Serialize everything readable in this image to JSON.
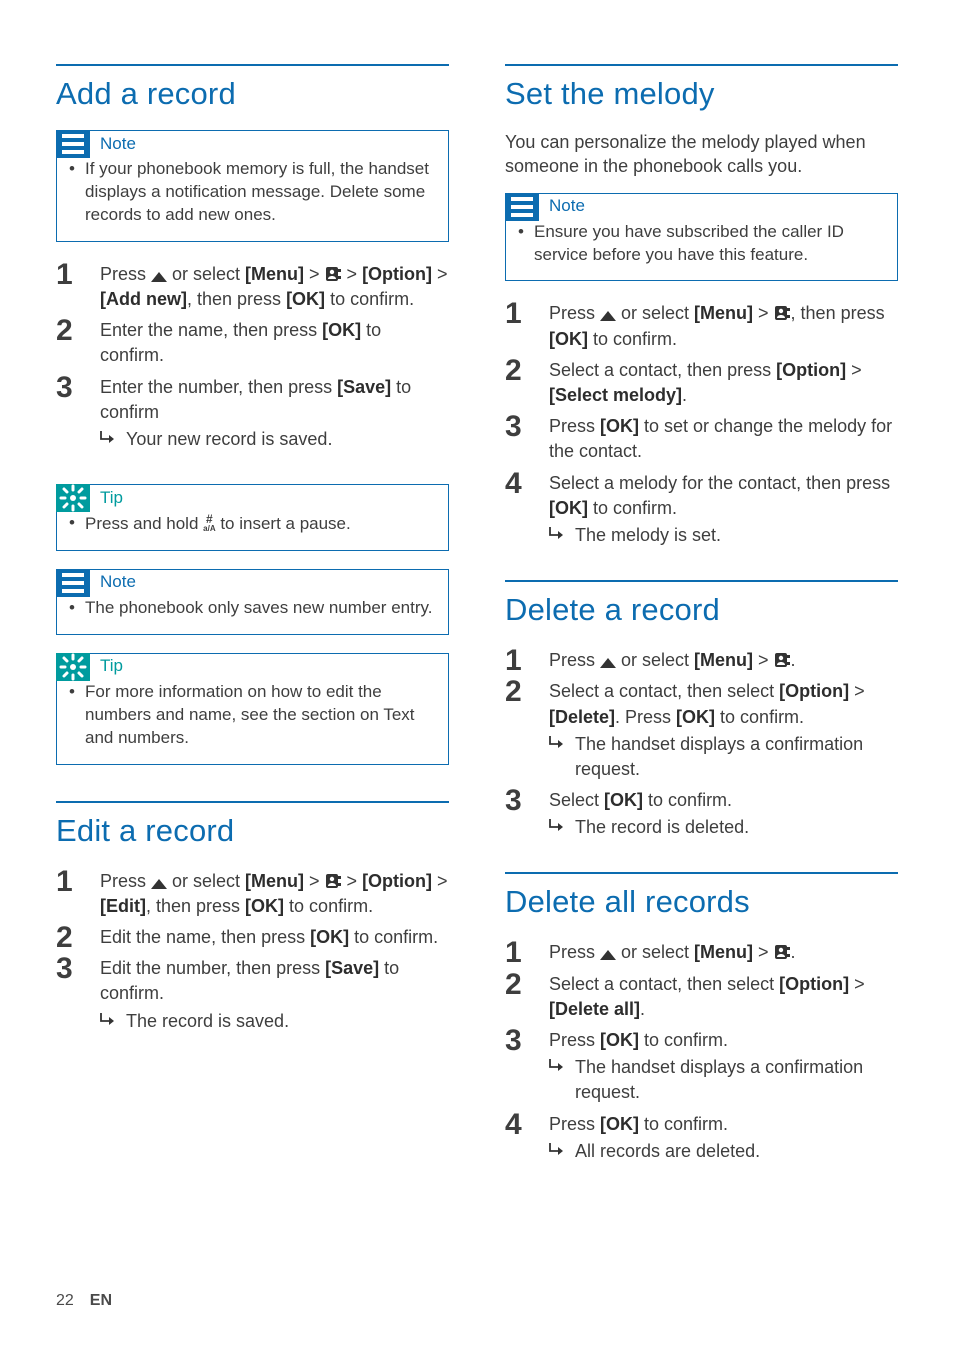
{
  "footer": {
    "page": "22",
    "lang": "EN"
  },
  "labels": {
    "note": "Note",
    "tip": "Tip"
  },
  "left": {
    "add": {
      "heading": "Add a record",
      "note1": "If your phonebook memory is full, the handset displays a notification message. Delete some records to add new ones.",
      "steps": [
        {
          "pre": "Press ",
          "seq": [
            " or select ",
            "[Menu]",
            " > ",
            "PB",
            " > ",
            "[Option]",
            " > ",
            "[Add new]",
            ", then press ",
            "[OK]",
            " to confirm."
          ]
        },
        {
          "pre": "Enter the name, then press ",
          "seq": [
            "[OK]",
            " to confirm."
          ]
        },
        {
          "pre": "Enter the number, then press ",
          "seq": [
            "[Save]",
            " to confirm"
          ],
          "result": "Your new record is saved."
        }
      ],
      "tip1_a": "Press and hold ",
      "tip1_b": " to insert a pause.",
      "note2": "The phonebook only saves new number entry.",
      "tip2": "For more information on how to edit the numbers and name, see the section on Text and numbers."
    },
    "edit": {
      "heading": "Edit a record",
      "steps": [
        {
          "pre": "Press ",
          "seq": [
            " or select ",
            "[Menu]",
            " > ",
            "PB",
            " > ",
            "[Option]",
            " > ",
            "[Edit]",
            ", then press ",
            "[OK]",
            " to confirm."
          ]
        },
        {
          "pre": "Edit the name, then press ",
          "seq": [
            "[OK]",
            " to confirm."
          ]
        },
        {
          "pre": "Edit the number, then press ",
          "seq": [
            "[Save]",
            " to confirm."
          ],
          "result": "The record is saved."
        }
      ]
    }
  },
  "right": {
    "melody": {
      "heading": "Set the melody",
      "intro": "You can personalize the melody played when someone in the phonebook calls you.",
      "note": "Ensure you have subscribed the caller ID service before you have this feature.",
      "steps": [
        {
          "pre": "Press ",
          "seq": [
            " or select ",
            "[Menu]",
            " > ",
            "PB",
            ", then press ",
            "[OK]",
            " to confirm."
          ]
        },
        {
          "pre": "Select a contact, then press ",
          "seq": [
            "[Option]",
            " > ",
            "[Select melody]",
            "."
          ]
        },
        {
          "pre": "Press ",
          "seq": [
            "[OK]",
            " to set or change the melody for the contact."
          ]
        },
        {
          "pre": "Select a melody for the contact, then press ",
          "seq": [
            "[OK]",
            " to confirm."
          ],
          "result": "The melody is set."
        }
      ]
    },
    "delete": {
      "heading": "Delete a record",
      "steps": [
        {
          "pre": "Press ",
          "seq": [
            " or select ",
            "[Menu]",
            " > ",
            "PB",
            "."
          ]
        },
        {
          "pre": "Select a contact, then select ",
          "seq": [
            "[Option]",
            " > ",
            "[Delete]",
            ". Press ",
            "[OK]",
            " to confirm."
          ],
          "result": "The handset displays a confirmation request."
        },
        {
          "pre": "Select ",
          "seq": [
            "[OK]",
            " to confirm."
          ],
          "result": "The record is deleted."
        }
      ]
    },
    "deleteAll": {
      "heading": "Delete all records",
      "steps": [
        {
          "pre": "Press ",
          "seq": [
            " or select ",
            "[Menu]",
            " > ",
            "PB",
            "."
          ]
        },
        {
          "pre": "Select a contact, then select ",
          "seq": [
            "[Option]",
            " > ",
            "[Delete all]",
            "."
          ]
        },
        {
          "pre": "Press ",
          "seq": [
            "[OK]",
            " to confirm."
          ],
          "result": "The handset displays a confirmation request."
        },
        {
          "pre": "Press ",
          "seq": [
            "[OK]",
            " to confirm."
          ],
          "result": "All records are deleted."
        }
      ]
    }
  }
}
